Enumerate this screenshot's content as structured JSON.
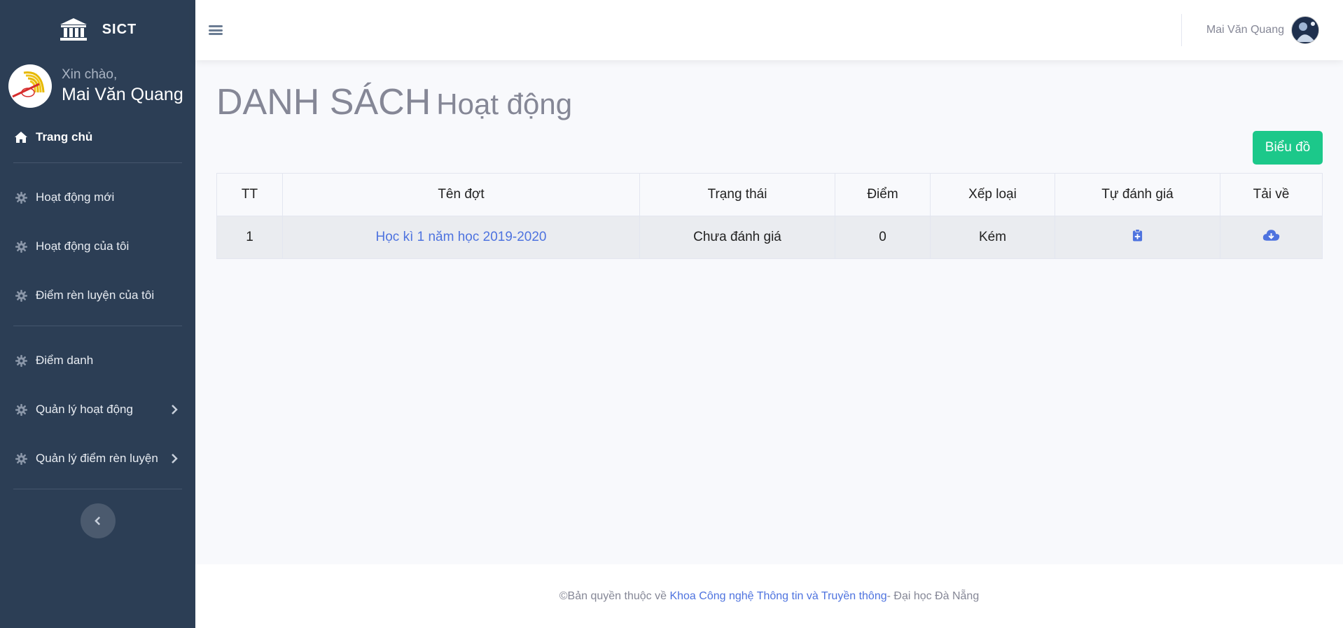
{
  "brand": {
    "name": "SICT"
  },
  "sidebar": {
    "greeting": "Xin chào,",
    "user_name": "Mai Văn Quang",
    "home_label": "Trang chủ",
    "items": [
      {
        "label": "Hoạt động mới"
      },
      {
        "label": "Hoạt động của tôi"
      },
      {
        "label": "Điểm rèn luyện của tôi"
      },
      {
        "label": "Điểm danh"
      },
      {
        "label": "Quản lý hoạt động"
      },
      {
        "label": "Quản lý điểm rèn luyện"
      }
    ]
  },
  "topbar": {
    "user_name": "Mai Văn Quang"
  },
  "page": {
    "title_main": "DANH SÁCH",
    "title_sub": "Hoạt động",
    "chart_button": "Biểu đồ"
  },
  "table": {
    "headers": [
      "TT",
      "Tên đợt",
      "Trạng thái",
      "Điểm",
      "Xếp loại",
      "Tự đánh giá",
      "Tải về"
    ],
    "rows": [
      {
        "tt": "1",
        "ten_dot": "Học kì 1 năm học 2019-2020",
        "trang_thai": "Chưa đánh giá",
        "diem": "0",
        "xep_loai": "Kém"
      }
    ]
  },
  "footer": {
    "prefix": "©Bản quyền thuộc về ",
    "link": "Khoa Công nghệ Thông tin và Truyền thông",
    "suffix": " - Đại học Đà Nẵng"
  },
  "colors": {
    "sidebar": "#2c3e55",
    "accent": "#4e73df",
    "success": "#1cc88a"
  }
}
